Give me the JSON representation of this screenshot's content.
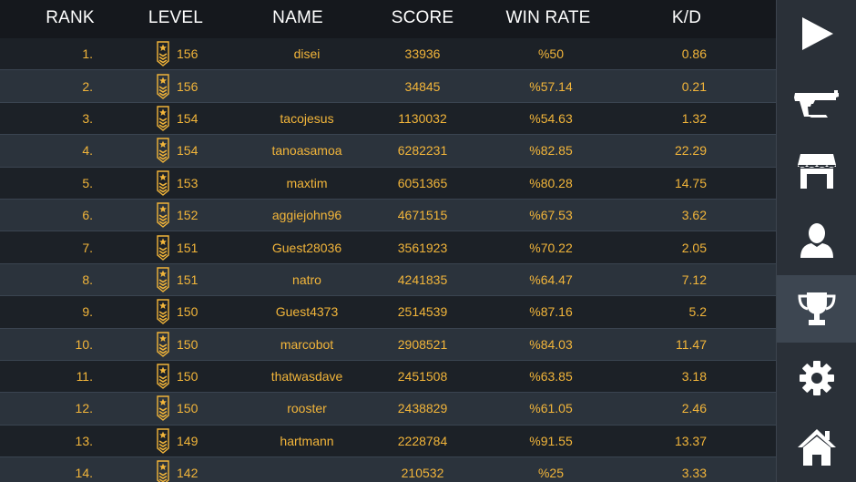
{
  "header": {
    "rank": "RANK",
    "level": "LEVEL",
    "name": "NAME",
    "score": "SCORE",
    "win_rate": "WIN RATE",
    "kd": "K/D"
  },
  "rows": [
    {
      "rank": "1.",
      "level": "156",
      "name": "disei",
      "score": "33936",
      "win_rate": "%50",
      "kd": "0.86"
    },
    {
      "rank": "2.",
      "level": "156",
      "name": "",
      "score": "34845",
      "win_rate": "%57.14",
      "kd": "0.21"
    },
    {
      "rank": "3.",
      "level": "154",
      "name": "tacojesus",
      "score": "1130032",
      "win_rate": "%54.63",
      "kd": "1.32"
    },
    {
      "rank": "4.",
      "level": "154",
      "name": "tanoasamoa",
      "score": "6282231",
      "win_rate": "%82.85",
      "kd": "22.29"
    },
    {
      "rank": "5.",
      "level": "153",
      "name": "maxtim",
      "score": "6051365",
      "win_rate": "%80.28",
      "kd": "14.75"
    },
    {
      "rank": "6.",
      "level": "152",
      "name": "aggiejohn96",
      "score": "4671515",
      "win_rate": "%67.53",
      "kd": "3.62"
    },
    {
      "rank": "7.",
      "level": "151",
      "name": "Guest28036",
      "score": "3561923",
      "win_rate": "%70.22",
      "kd": "2.05"
    },
    {
      "rank": "8.",
      "level": "151",
      "name": "natro",
      "score": "4241835",
      "win_rate": "%64.47",
      "kd": "7.12"
    },
    {
      "rank": "9.",
      "level": "150",
      "name": "Guest4373",
      "score": "2514539",
      "win_rate": "%87.16",
      "kd": "5.2"
    },
    {
      "rank": "10.",
      "level": "150",
      "name": "marcobot",
      "score": "2908521",
      "win_rate": "%84.03",
      "kd": "11.47"
    },
    {
      "rank": "11.",
      "level": "150",
      "name": "thatwasdave",
      "score": "2451508",
      "win_rate": "%63.85",
      "kd": "3.18"
    },
    {
      "rank": "12.",
      "level": "150",
      "name": "rooster",
      "score": "2438829",
      "win_rate": "%61.05",
      "kd": "2.46"
    },
    {
      "rank": "13.",
      "level": "149",
      "name": "hartmann",
      "score": "2228784",
      "win_rate": "%91.55",
      "kd": "13.37"
    },
    {
      "rank": "14.",
      "level": "142",
      "name": "",
      "score": "210532",
      "win_rate": "%25",
      "kd": "3.33"
    }
  ],
  "sidebar": {
    "items": [
      {
        "icon": "play-icon",
        "active": false
      },
      {
        "icon": "pistol-icon",
        "active": false
      },
      {
        "icon": "shop-icon",
        "active": false
      },
      {
        "icon": "profile-icon",
        "active": false
      },
      {
        "icon": "trophy-icon",
        "active": true
      },
      {
        "icon": "gear-icon",
        "active": false
      },
      {
        "icon": "home-icon",
        "active": false
      }
    ]
  },
  "colors": {
    "value_text": "#f2b53a",
    "header_text": "#ffffff",
    "row_light": "#2b333c",
    "row_dark": "#1c2127",
    "sidebar_bg": "#2a3038",
    "sidebar_active": "#3d4651"
  }
}
